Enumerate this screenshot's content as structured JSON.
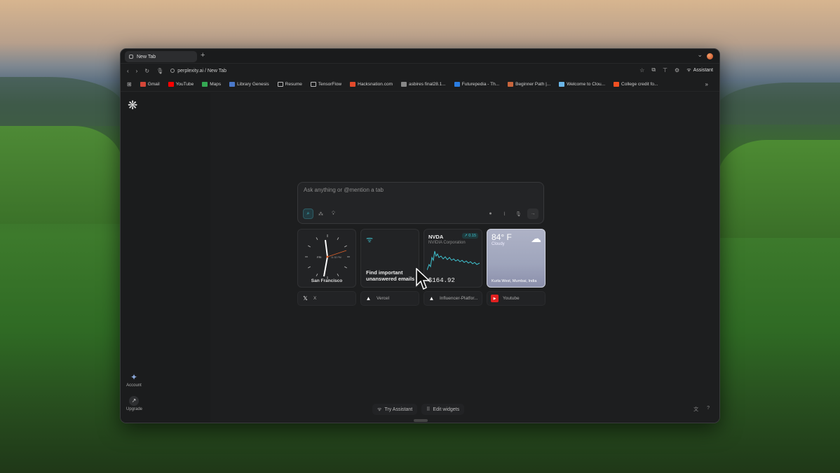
{
  "browser": {
    "tab_title": "New Tab",
    "new_tab": "+",
    "address": "perplexity.ai / New Tab",
    "assistant_label": "Assistant"
  },
  "bookmarks": [
    {
      "label": "Gmail",
      "color": "#d44638"
    },
    {
      "label": "YouTube",
      "color": "#ff0000"
    },
    {
      "label": "Maps",
      "color": "#34a853"
    },
    {
      "label": "Library Genesis",
      "color": "#4a78c9"
    },
    {
      "label": "Resume",
      "color": "folder"
    },
    {
      "label": "TensorFlow",
      "color": "folder"
    },
    {
      "label": "Hacksnation.com",
      "color": "#e24a2b"
    },
    {
      "label": "asbires final28.1...",
      "color": "#888888"
    },
    {
      "label": "Futurepedia - Th...",
      "color": "#2a7de1"
    },
    {
      "label": "Beginner Path |...",
      "color": "#c8653c"
    },
    {
      "label": "Welcome to Clou...",
      "color": "#6bb6e8"
    },
    {
      "label": "College credit fo...",
      "color": "#f25022"
    }
  ],
  "sidebar": {
    "account_label": "Account",
    "upgrade_label": "Upgrade"
  },
  "search": {
    "placeholder": "Ask anything or @mention a tab"
  },
  "widgets": {
    "clock": {
      "city": "San Francisco",
      "day": "FRI",
      "time_small": "11:32 PM"
    },
    "email": {
      "text": "Find important unanswered emails"
    },
    "stock": {
      "symbol": "NVDA",
      "company": "NVIDIA Corporation",
      "change": "↗ 0.15",
      "price": "$164.92"
    },
    "weather": {
      "temp": "84° F",
      "condition": "Cloudy",
      "location": "Kurla West, Mumbai, India"
    }
  },
  "shortcuts": [
    {
      "label": "X",
      "icon": "x-logo-icon"
    },
    {
      "label": "Vercel",
      "icon": "vercel-icon"
    },
    {
      "label": "Influencer-Platfor...",
      "icon": "vercel-icon"
    },
    {
      "label": "Youtube",
      "icon": "youtube-icon"
    }
  ],
  "bottom": {
    "try_assistant": "Try Assistant",
    "edit_widgets": "Edit widgets"
  },
  "colors": {
    "accent": "#3fc2cf",
    "window_bg": "#1c1d1e"
  }
}
